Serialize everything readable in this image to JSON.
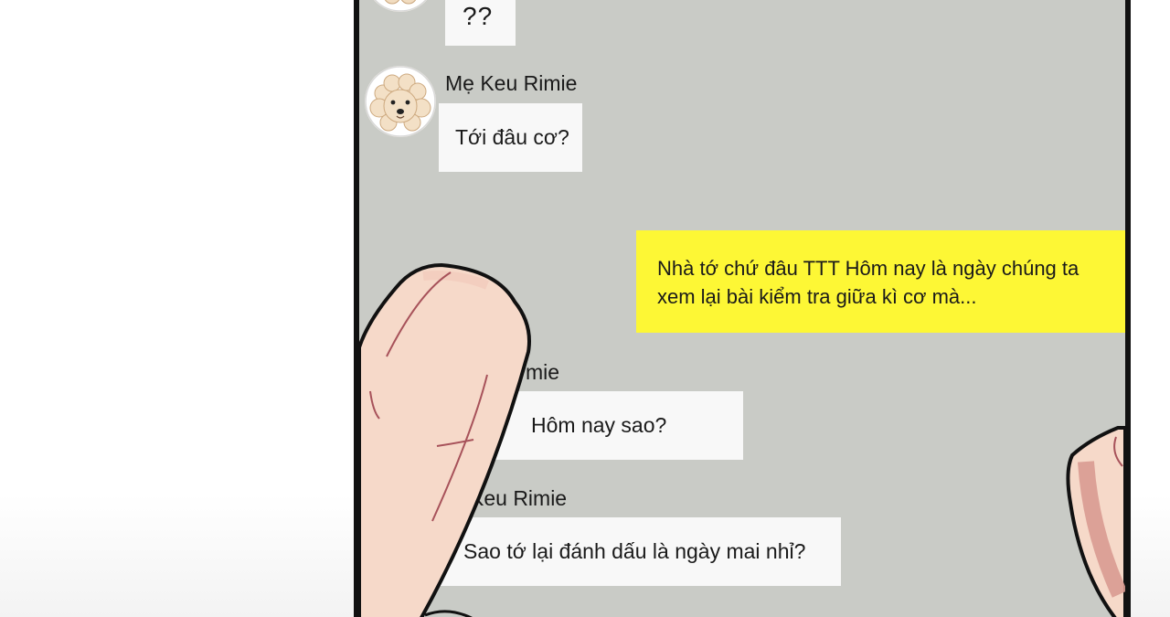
{
  "messages": [
    {
      "sender": "",
      "text": "??",
      "side": "left"
    },
    {
      "sender": "Mẹ Keu Rimie",
      "text": "Tới đâu cơ?",
      "side": "left"
    },
    {
      "sender": "",
      "text": "Nhà tớ chứ đâu TTT Hôm nay là ngày chúng ta xem lại bài kiểm tra giữa kì cơ mà...",
      "side": "right"
    },
    {
      "sender": "mie",
      "text": "Hôm nay sao?",
      "side": "left"
    },
    {
      "sender": "Keu Rimie",
      "text": "Sao tớ lại đánh dấu là ngày mai nhỉ?",
      "side": "left"
    }
  ],
  "colors": {
    "chat_background": "#c9cbc6",
    "incoming_bubble": "#f8f8f8",
    "outgoing_bubble": "#fdf735",
    "frame": "#111111",
    "skin": "#f6d9c9"
  },
  "icons": {
    "avatar": "poodle-avatar-icon"
  }
}
